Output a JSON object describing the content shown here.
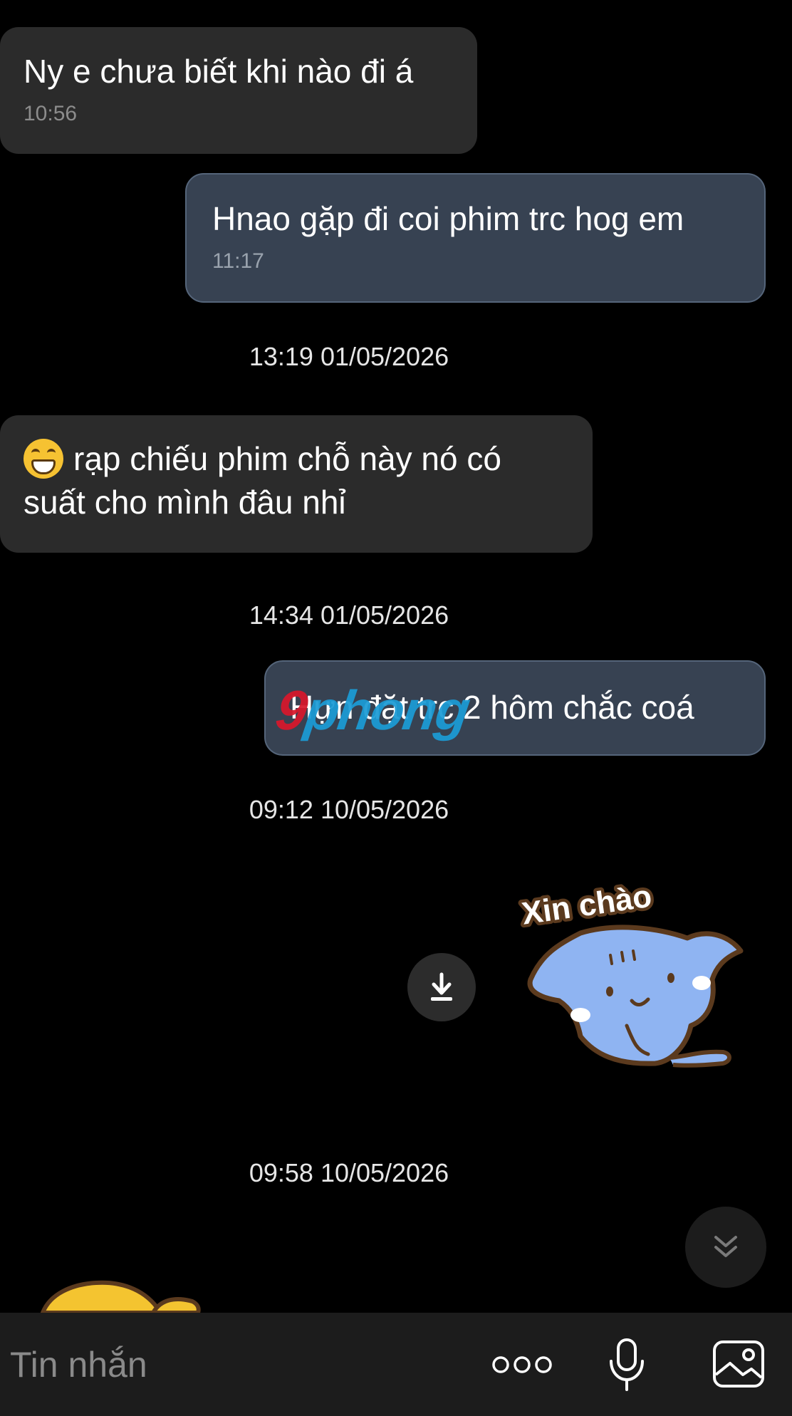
{
  "messages": [
    {
      "text": "Ny e chưa biết khi nào đi á",
      "time": "10:56"
    },
    {
      "text": "Hnao gặp đi coi phim trc hog em",
      "time": "11:17"
    },
    {
      "line1": "rạp chiếu phim chỗ này nó có",
      "line2": "suất cho mình đâu nhỉ",
      "emoji": "grinning-face"
    },
    {
      "text": "Hựn đặt trc 2 hôm chắc coá"
    }
  ],
  "dividers": [
    "13:19 01/05/2026",
    "14:34 01/05/2026",
    "09:12 10/05/2026",
    "09:58 10/05/2026"
  ],
  "watermark": {
    "part1": "9",
    "part2": "phong"
  },
  "sticker": {
    "caption": "Xin chào"
  },
  "input": {
    "placeholder": "Tin nhắn"
  },
  "colors": {
    "background": "#000000",
    "incoming": "#2b2b2b",
    "outgoing": "#374252",
    "input_bar": "#1c1c1c"
  }
}
